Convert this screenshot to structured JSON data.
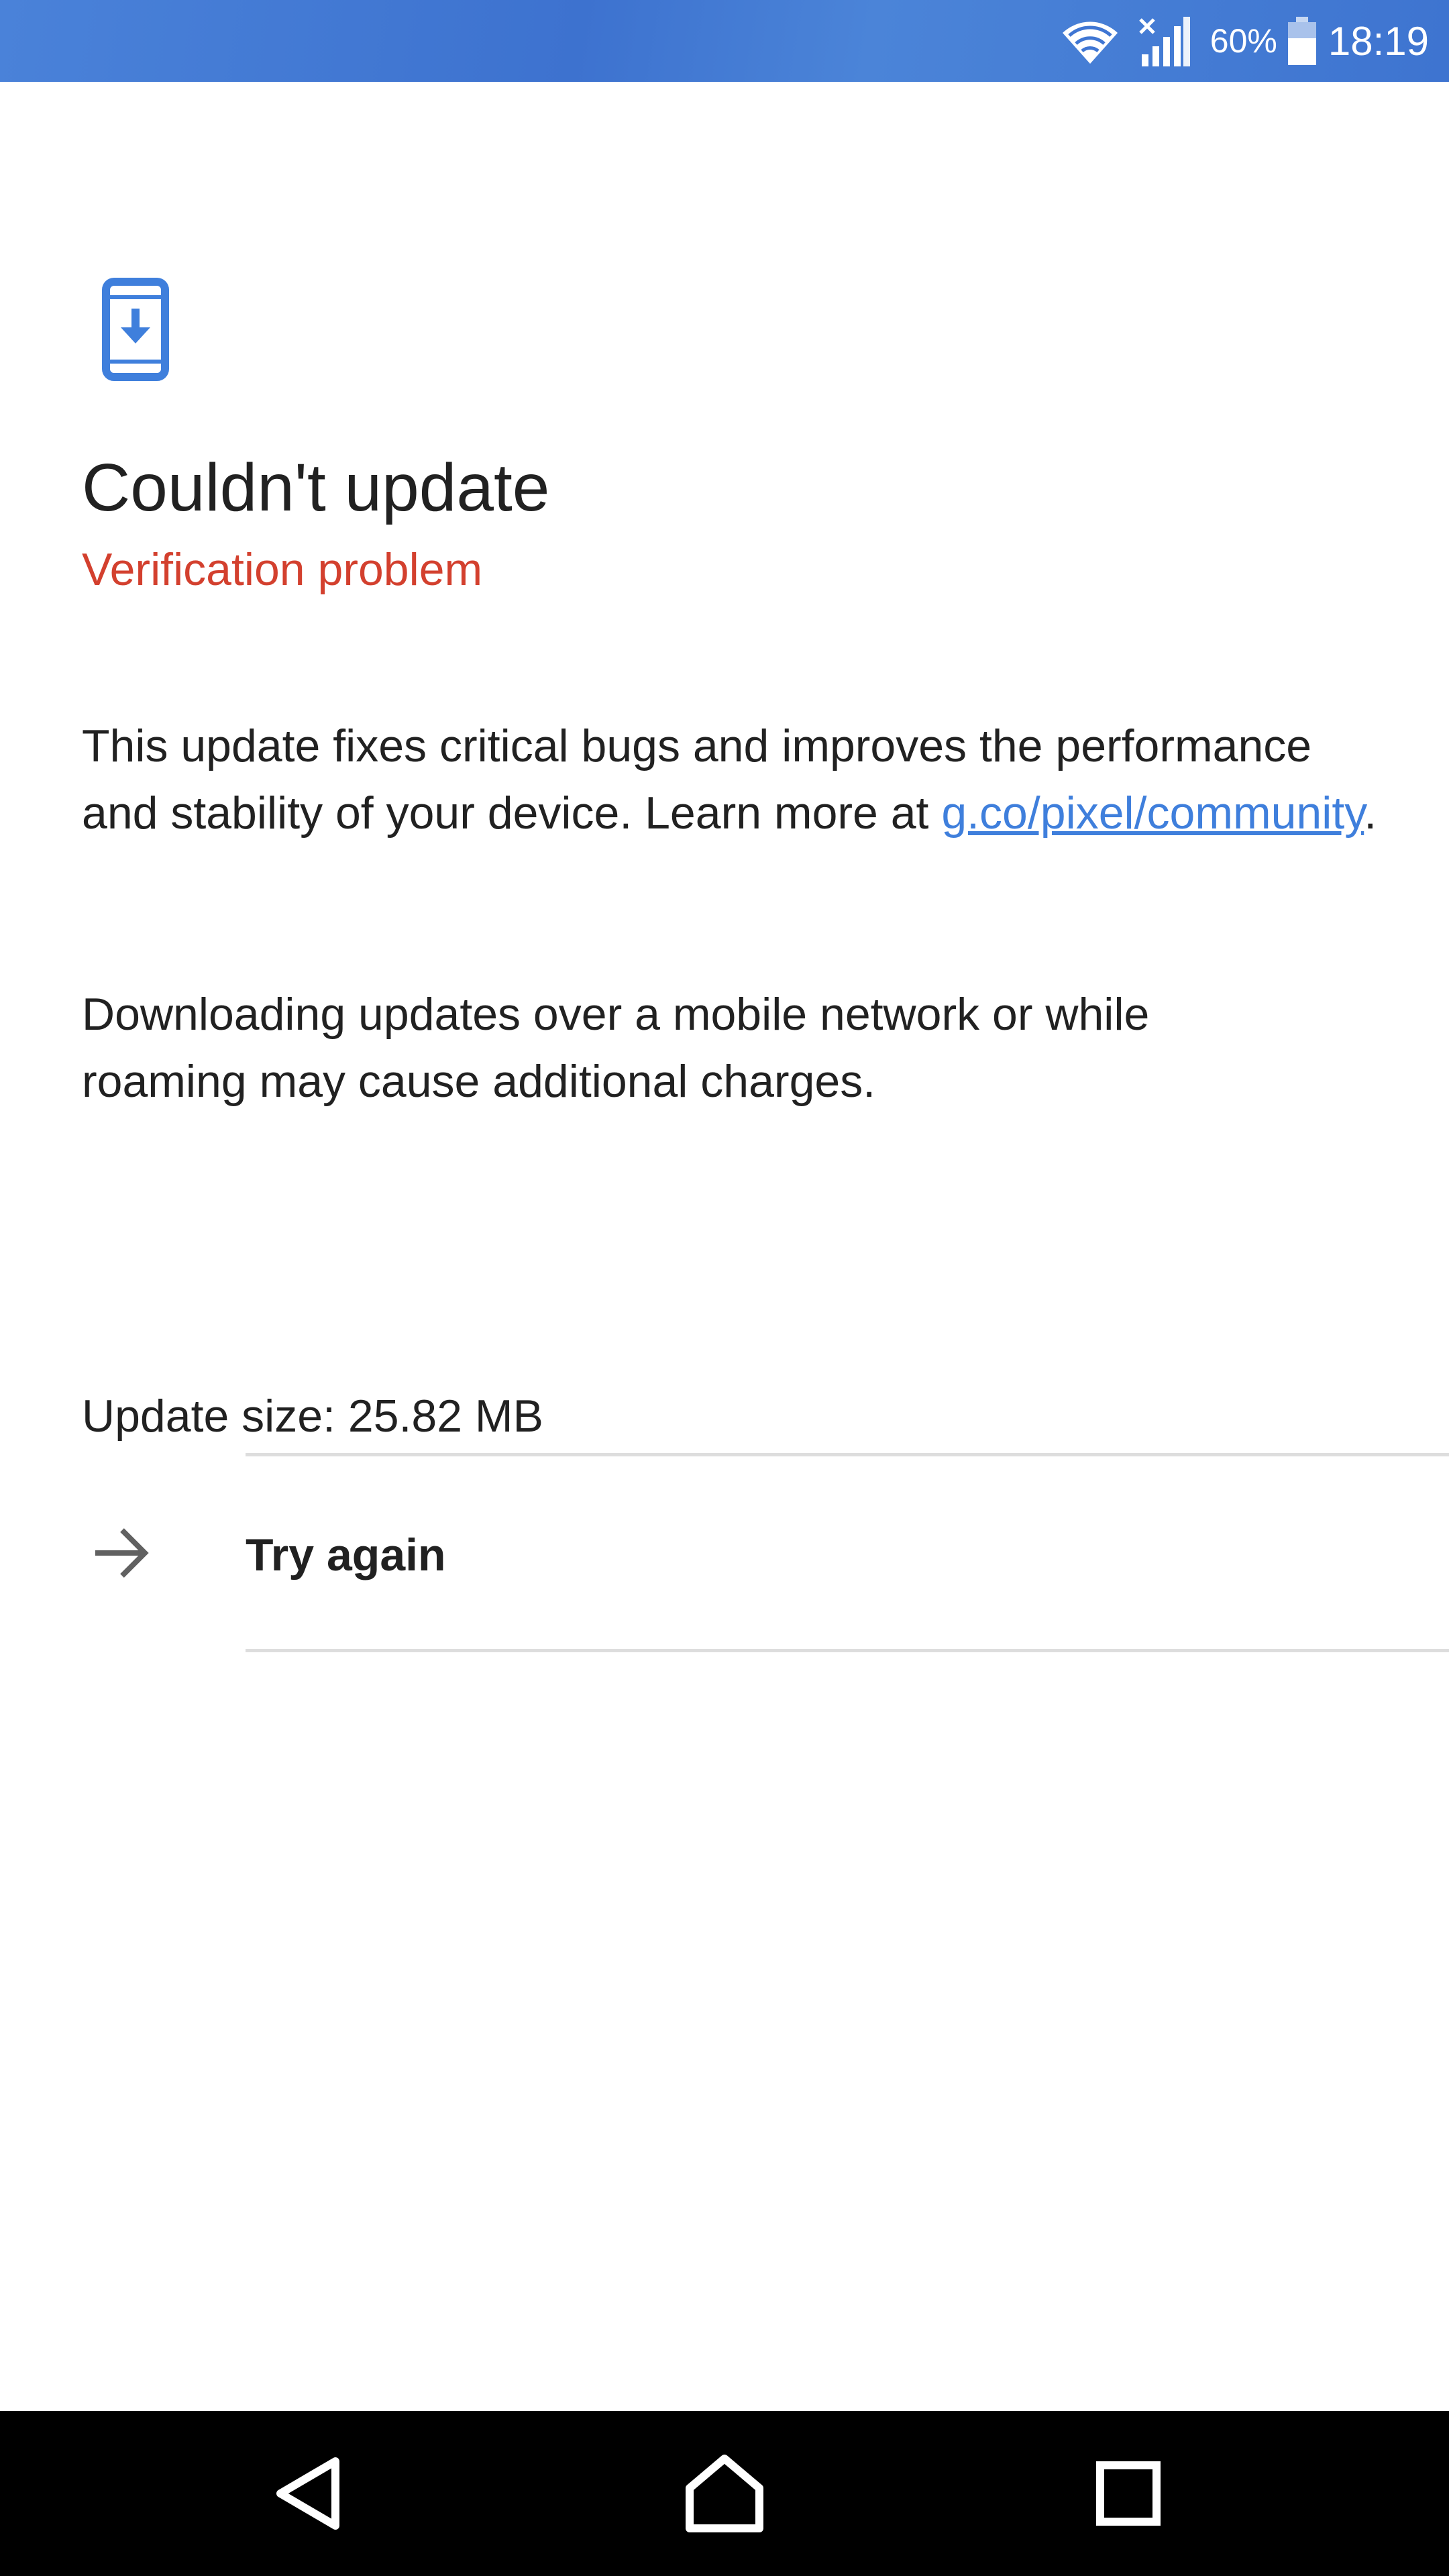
{
  "status_bar": {
    "battery_percent": "60%",
    "time": "18:19",
    "icons": [
      "wifi-icon",
      "cellular-signal-icon",
      "battery-icon"
    ]
  },
  "header": {
    "icon": "system-update-icon",
    "title": "Couldn't update",
    "subtitle": "Verification problem"
  },
  "body": {
    "description_text": "This update fixes critical bugs and improves the performance and stability of your device. Learn more at ",
    "link_text": "g.co/pixel/community",
    "description_end": ".",
    "charges_notice": "Downloading updates over a mobile network or while roaming may cause additional charges.",
    "update_size": "Update size: 25.82 MB"
  },
  "actions": {
    "try_again_label": "Try again",
    "try_again_icon": "arrow-forward-icon"
  },
  "nav_bar": {
    "buttons": [
      "back-icon",
      "home-icon",
      "recents-icon"
    ]
  },
  "colors": {
    "status_bar": "#3f76d3",
    "accent_blue": "#3f7fdc",
    "error_red": "#d3402e",
    "text": "#212121"
  }
}
